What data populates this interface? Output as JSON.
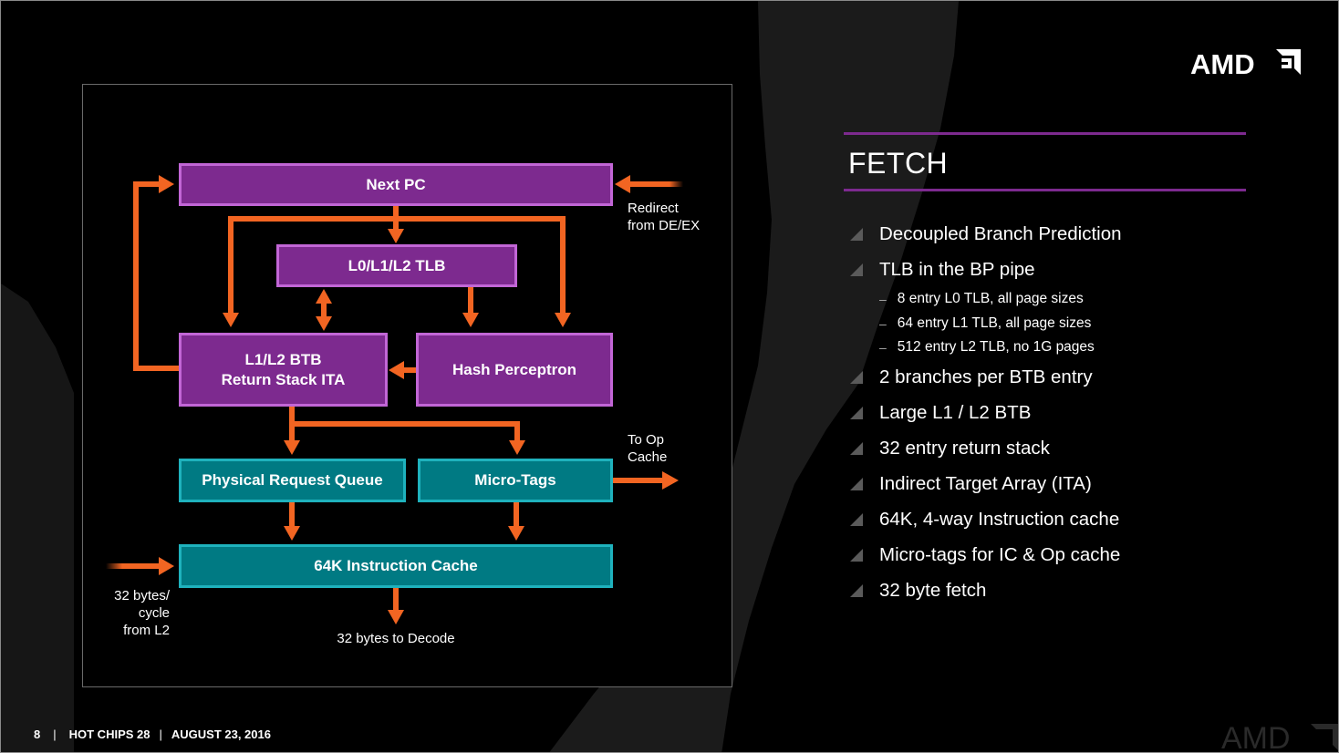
{
  "slide": {
    "logo": "AMD",
    "title": "FETCH",
    "accent_color": "#7d2a8f",
    "arrow_color": "#f26522",
    "purple_box_color": "#7d2a8f",
    "teal_box_color": "#007a83"
  },
  "diagram": {
    "boxes": {
      "next_pc": "Next PC",
      "tlb": "L0/L1/L2 TLB",
      "btb_line1": "L1/L2 BTB",
      "btb_line2": "Return Stack ITA",
      "hash_perceptron": "Hash Perceptron",
      "physical_request_queue": "Physical Request Queue",
      "micro_tags": "Micro-Tags",
      "instruction_cache": "64K Instruction Cache"
    },
    "labels": {
      "redirect_line1": "Redirect",
      "redirect_line2": "from DE/EX",
      "to_op_line1": "To Op",
      "to_op_line2": "Cache",
      "from_l2_line1": "32 bytes/",
      "from_l2_line2": "cycle",
      "from_l2_line3": "from L2",
      "to_decode": "32 bytes to Decode"
    }
  },
  "bullets": [
    {
      "level": 1,
      "text": "Decoupled Branch Prediction"
    },
    {
      "level": 1,
      "text": "TLB in the BP pipe"
    },
    {
      "level": 2,
      "text": "8 entry L0 TLB, all page sizes"
    },
    {
      "level": 2,
      "text": "64 entry L1 TLB, all page sizes"
    },
    {
      "level": 2,
      "text": "512 entry L2 TLB, no 1G pages"
    },
    {
      "level": 1,
      "text": "2 branches per BTB entry"
    },
    {
      "level": 1,
      "text": "Large L1 / L2 BTB"
    },
    {
      "level": 1,
      "text": "32 entry return stack"
    },
    {
      "level": 1,
      "text": "Indirect Target Array (ITA)"
    },
    {
      "level": 1,
      "text": "64K, 4-way Instruction cache"
    },
    {
      "level": 1,
      "text": "Micro-tags for IC & Op cache"
    },
    {
      "level": 1,
      "text": "32 byte fetch"
    }
  ],
  "footer": {
    "page_number": "8",
    "separator": "|",
    "event": "HOT CHIPS 28",
    "date": "AUGUST 23, 2016"
  }
}
